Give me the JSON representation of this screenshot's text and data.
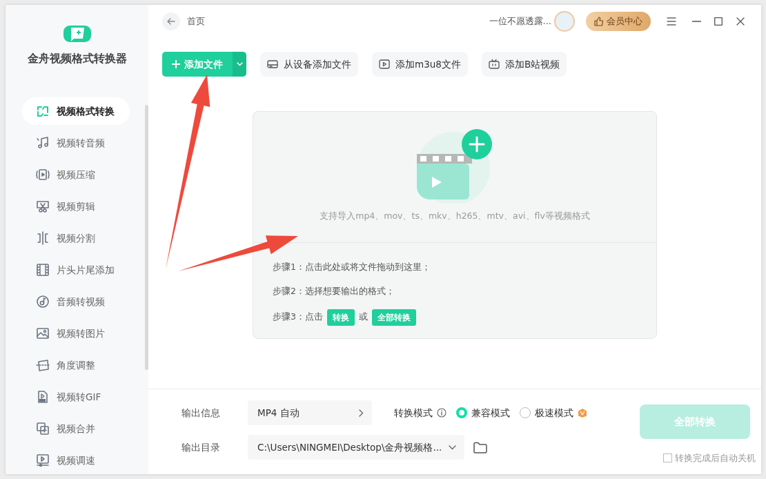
{
  "app": {
    "name": "金舟视频格式转换器"
  },
  "sidebar": {
    "items": [
      {
        "label": "视频格式转换",
        "selected": true
      },
      {
        "label": "视频转音频",
        "selected": false
      },
      {
        "label": "视频压缩",
        "selected": false
      },
      {
        "label": "视频剪辑",
        "selected": false
      },
      {
        "label": "视频分割",
        "selected": false
      },
      {
        "label": "片头片尾添加",
        "selected": false
      },
      {
        "label": "音频转视频",
        "selected": false
      },
      {
        "label": "视频转图片",
        "selected": false
      },
      {
        "label": "角度调整",
        "selected": false
      },
      {
        "label": "视频转GIF",
        "selected": false
      },
      {
        "label": "视频合并",
        "selected": false
      },
      {
        "label": "视频调速",
        "selected": false
      }
    ]
  },
  "header": {
    "breadcrumb": "首页",
    "username": "一位不愿透露...",
    "vip_button": "会员中心"
  },
  "toolbar": {
    "add_file": "添加文件",
    "buttons": [
      "从设备添加文件",
      "添加m3u8文件",
      "添加B站视频"
    ]
  },
  "drop_zone": {
    "hint": "支持导入mp4、mov、ts、mkv、h265、mtv、avi、flv等视频格式",
    "step1": "步骤1：点击此处或将文件拖动到这里；",
    "step2": "步骤2：选择想要输出的格式；",
    "step3_prefix": "步骤3：点击",
    "step3_tag1": "转换",
    "step3_or": "或",
    "step3_tag2": "全部转换"
  },
  "output": {
    "info_label": "输出信息",
    "format": "MP4 自动",
    "mode_label": "转换模式",
    "modes": [
      {
        "label": "兼容模式",
        "selected": true
      },
      {
        "label": "极速模式",
        "selected": false
      }
    ],
    "dir_label": "输出目录",
    "dir": "C:\\Users\\NINGMEI\\Desktop\\金舟视频格...",
    "convert_all": "全部转换",
    "convert_all_disabled": true,
    "shutdown": {
      "label": "转换完成后自动关机",
      "checked": false
    }
  }
}
